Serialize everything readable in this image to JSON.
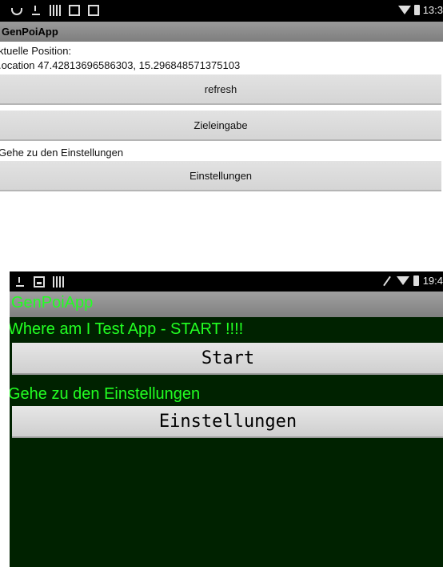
{
  "top": {
    "status_time": "13:3",
    "app_title": "GenPoiApp",
    "position_label": "ktuelle Position:",
    "location_text": ".ocation 47.42813696586303, 15.296848571375103",
    "refresh_label": "refresh",
    "zieleingabe_label": "Zieleingabe",
    "settings_hint": "Gehe zu den Einstellungen",
    "settings_label": "Einstellungen"
  },
  "bottom": {
    "status_time": "19:4",
    "app_title": "GenPoiApp",
    "heading": "Where am I Test App - START !!!!",
    "start_label": "Start",
    "settings_hint": "Gehe zu den Einstellungen",
    "settings_label": "Einstellungen"
  },
  "colors": {
    "bottom_background": "#002200",
    "bottom_text": "#22ff22"
  }
}
